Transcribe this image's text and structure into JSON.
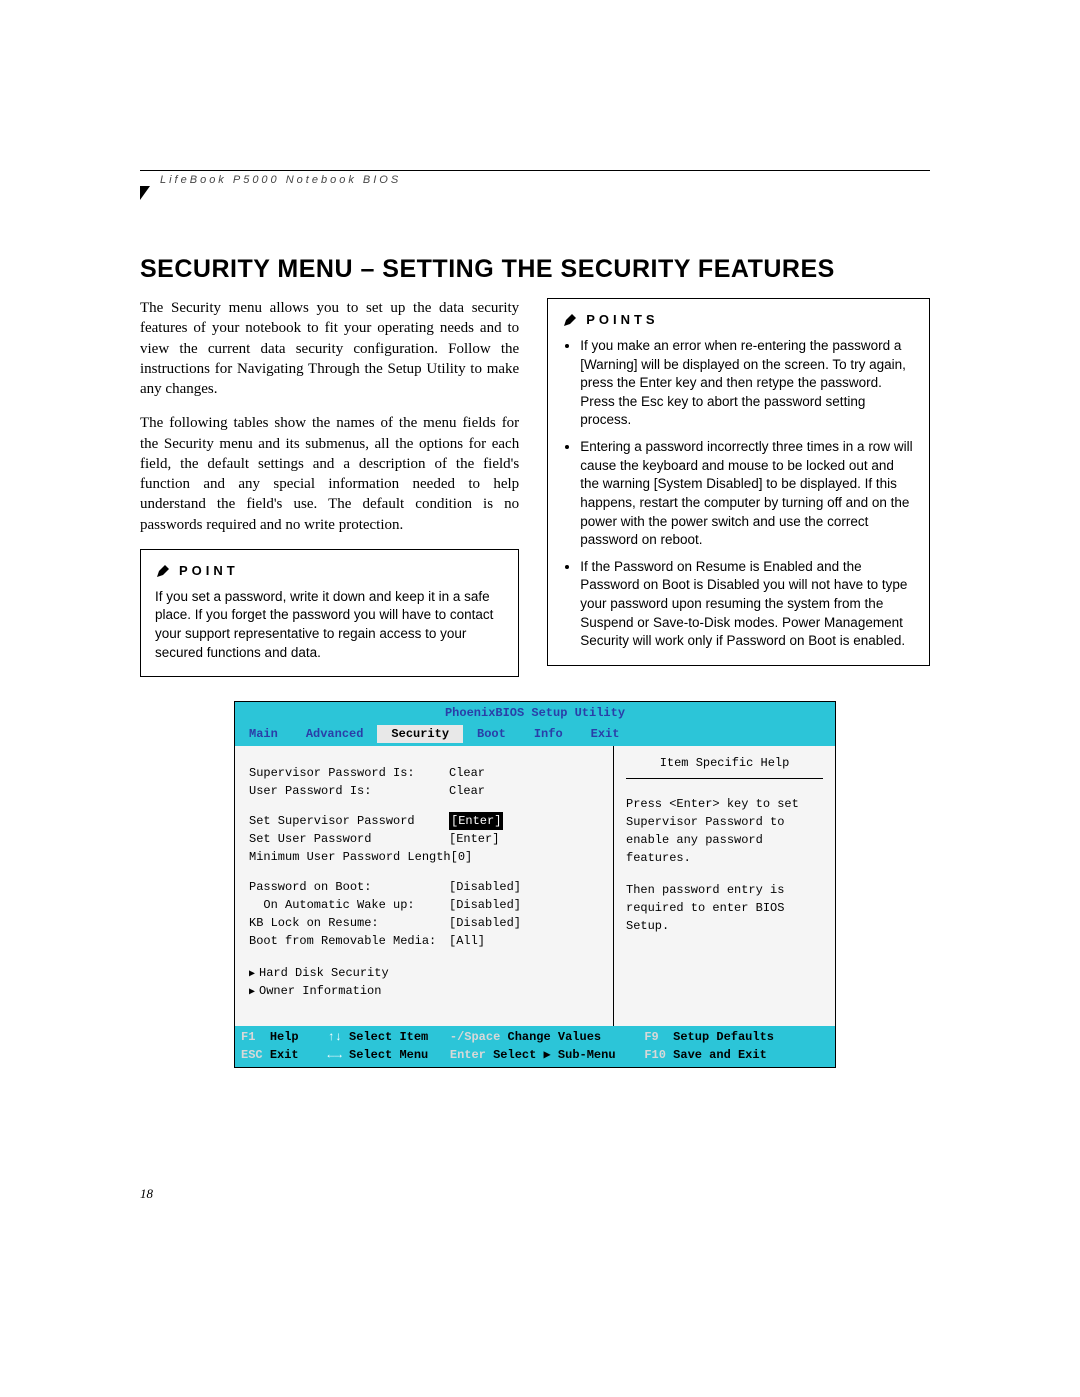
{
  "header": "LifeBook P5000 Notebook BIOS",
  "title": "SECURITY MENU – SETTING THE SECURITY FEATURES",
  "para1": "The Security menu allows you to set up the data security features of your notebook to fit your operating needs and to view the current data security configuration. Follow the instructions for Navigating Through the Setup Utility to make any changes.",
  "para2": "The following tables show the names of the menu fields for the Security menu and its submenus, all the options for each field, the default settings and a description of the field's function and any special information needed to help understand the field's use. The default condition is no passwords required and no write protection.",
  "point": {
    "label": "POINT",
    "text": "If you set a password, write it down and keep it in a safe place. If you forget the password you will have to contact your support representative to regain access to your secured functions and data."
  },
  "points": {
    "label": "POINTS",
    "items": [
      "If you make an error when re-entering the password a [Warning] will be displayed on the screen. To try again, press the Enter key and then retype the password. Press the Esc key to abort the password setting process.",
      "Entering a password incorrectly three times in a row will cause the keyboard and mouse to be locked out and the warning [System Disabled] to be displayed. If this happens, restart the computer by turning off and on the power with the power switch and use the correct password on reboot.",
      "If the Password on Resume is Enabled and the Password on Boot is Disabled you will not have to type your password upon resuming the system from the Suspend or Save-to-Disk modes. Power Management Security will work only if Password on Boot is enabled."
    ]
  },
  "bios": {
    "title": "PhoenixBIOS Setup Utility",
    "tabs": [
      "Main",
      "Advanced",
      "Security",
      "Boot",
      "Info",
      "Exit"
    ],
    "active_tab": "Security",
    "rows": [
      {
        "label": "Supervisor Password Is:",
        "value": "Clear"
      },
      {
        "label": "User Password Is:",
        "value": "Clear"
      }
    ],
    "rows2": [
      {
        "label": "Set Supervisor Password",
        "value": "[Enter]",
        "hl": true
      },
      {
        "label": "Set User Password",
        "value": "[Enter]"
      },
      {
        "label": "Minimum User Password Length",
        "value": "[0]"
      }
    ],
    "rows3": [
      {
        "label": "Password on Boot:",
        "value": "[Disabled]"
      },
      {
        "label": "  On Automatic Wake up:",
        "value": "[Disabled]"
      },
      {
        "label": "KB Lock on Resume:",
        "value": "[Disabled]"
      },
      {
        "label": "Boot from Removable Media:",
        "value": "[All]"
      }
    ],
    "subs": [
      "Hard Disk Security",
      "Owner Information"
    ],
    "help_title": "Item Specific Help",
    "help_text1": "Press <Enter> key to set Supervisor Password to enable any password features.",
    "help_text2": "Then password entry is required to enter BIOS Setup.",
    "footer": {
      "f1": "F1",
      "help": "Help",
      "arrows_v": "↑↓",
      "select_item": "Select Item",
      "minus": "-/Space",
      "change": "Change Values",
      "f9": "F9",
      "defaults": "Setup Defaults",
      "esc": "ESC",
      "exit": "Exit",
      "arrows_h": "←→",
      "select_menu": "Select Menu",
      "enter": "Enter",
      "select_sub": "Select ▶ Sub-Menu",
      "f10": "F10",
      "save": "Save and Exit"
    }
  },
  "page_number": "18"
}
